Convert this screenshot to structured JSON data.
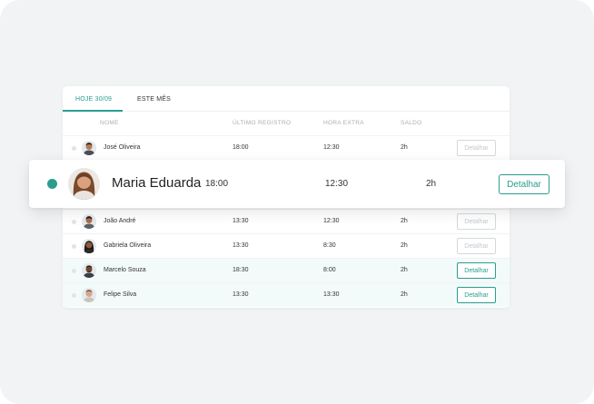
{
  "tabs": [
    {
      "label": "HOJE 30/09",
      "active": true
    },
    {
      "label": "ESTE MÊS",
      "active": false
    }
  ],
  "columns": {
    "name": "NOME",
    "last_record": "ÚLTIMO REGISTRO",
    "overtime": "HORA EXTRA",
    "balance": "SALDO"
  },
  "rows": [
    {
      "name": "José Oliveira",
      "last_record": "18:00",
      "overtime": "12:30",
      "balance": "2h",
      "action": "Detalhar",
      "action_enabled": false
    },
    {
      "name": "João André",
      "last_record": "13:30",
      "overtime": "12:30",
      "balance": "2h",
      "action": "Detalhar",
      "action_enabled": false
    },
    {
      "name": "Gabriela Oliveira",
      "last_record": "13:30",
      "overtime": "8:30",
      "balance": "2h",
      "action": "Detalhar",
      "action_enabled": false
    },
    {
      "name": "Marcelo Souza",
      "last_record": "18:30",
      "overtime": "8:00",
      "balance": "2h",
      "action": "Detalhar",
      "action_enabled": true
    },
    {
      "name": "Felipe Silva",
      "last_record": "13:30",
      "overtime": "13:30",
      "balance": "2h",
      "action": "Detalhar",
      "action_enabled": true
    }
  ],
  "highlight": {
    "name": "Maria Eduarda",
    "last_record": "18:00",
    "overtime": "12:30",
    "balance": "2h",
    "action": "Detalhar",
    "status": "active"
  },
  "colors": {
    "accent": "#2a9d8f",
    "muted": "#c3c8cc",
    "row_tint": "#f3fbfa"
  },
  "icons": [
    "person-avatar-icon",
    "status-dot-icon"
  ]
}
